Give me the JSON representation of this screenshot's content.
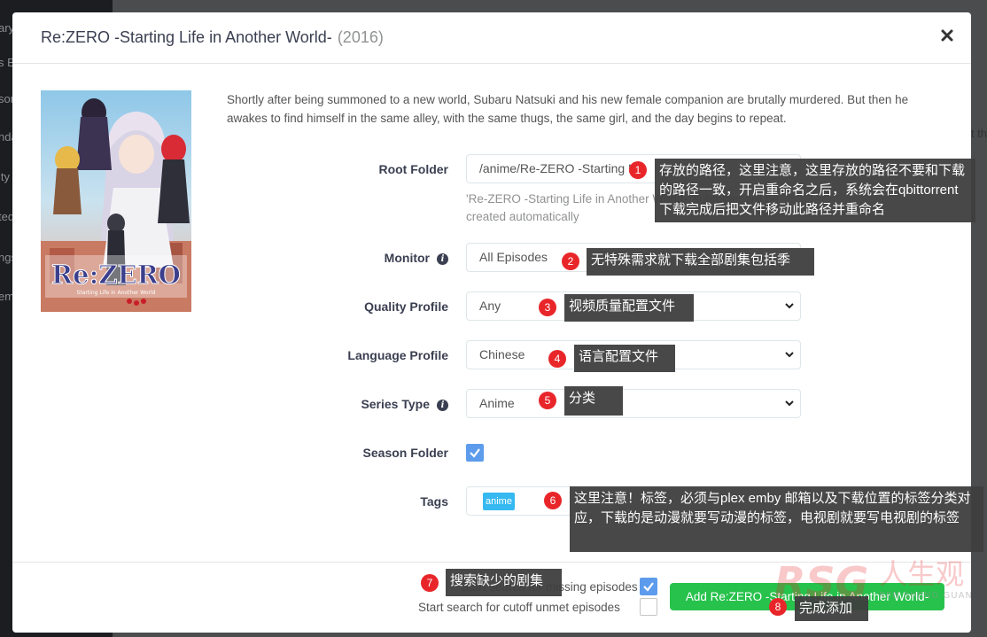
{
  "background": {
    "sidebar_items": [
      "ary",
      "s B",
      "son",
      "nda",
      "ity",
      "ted",
      "ngs",
      "em"
    ],
    "right_text": "nt th"
  },
  "modal": {
    "title": "Re:ZERO -Starting Life in Another World-",
    "year": "(2016)",
    "close_icon": "close-icon",
    "overview": "Shortly after being summoned to a new world, Subaru Natsuki and his new female companion are brutally murdered. But then he awakes to find himself in the same alley, with the same thugs, the same girl, and the day begins to repeat."
  },
  "poster": {
    "logo_text": "Re:ZERO",
    "sub_text": "Starting Life in Another World"
  },
  "form": {
    "root_folder": {
      "label": "Root Folder",
      "value": "/anime/Re-ZERO -Starting L",
      "help": "'Re-ZERO -Starting Life in Another World-' subfolder will be created automatically"
    },
    "monitor": {
      "label": "Monitor",
      "value": "All Episodes"
    },
    "quality_profile": {
      "label": "Quality Profile",
      "value": "Any"
    },
    "language_profile": {
      "label": "Language Profile",
      "value": "Chinese"
    },
    "series_type": {
      "label": "Series Type",
      "value": "Anime"
    },
    "season_folder": {
      "label": "Season Folder",
      "checked": true
    },
    "tags": {
      "label": "Tags",
      "items": [
        "anime"
      ]
    }
  },
  "footer": {
    "search_missing": {
      "label": "Start search for missing episodes",
      "checked": true
    },
    "search_cutoff": {
      "label": "Start search for cutoff unmet episodes",
      "checked": false
    },
    "add_button": "Add Re:ZERO -Starting Life in Another World-"
  },
  "annotations": [
    {
      "n": "1",
      "text": "存放的路径，这里注意，这里存放的路径不要和下载的路径一致，开启重命名之后，系统会在qbittorrent下载完成后把文件移动此路径并重命名"
    },
    {
      "n": "2",
      "text": "无特殊需求就下载全部剧集包括季"
    },
    {
      "n": "3",
      "text": "视频质量配置文件"
    },
    {
      "n": "4",
      "text": "语言配置文件"
    },
    {
      "n": "5",
      "text": "分类"
    },
    {
      "n": "6",
      "text": "这里注意！标签，必须与plex emby 邮箱以及下载位置的标签分类对应，下载的是动漫就要写动漫的标签，电视剧就要写电视剧的标签"
    },
    {
      "n": "7",
      "text": "搜索缺少的剧集"
    },
    {
      "n": "8",
      "text": "完成添加"
    }
  ],
  "watermark": {
    "brand": "RSG",
    "cn": "人生观",
    "pinyin": "REN SHENG GUAN"
  },
  "colors": {
    "accent": "#5d9cec",
    "success": "#27c24c",
    "tag": "#36b9f1",
    "marker": "#e8262a"
  }
}
